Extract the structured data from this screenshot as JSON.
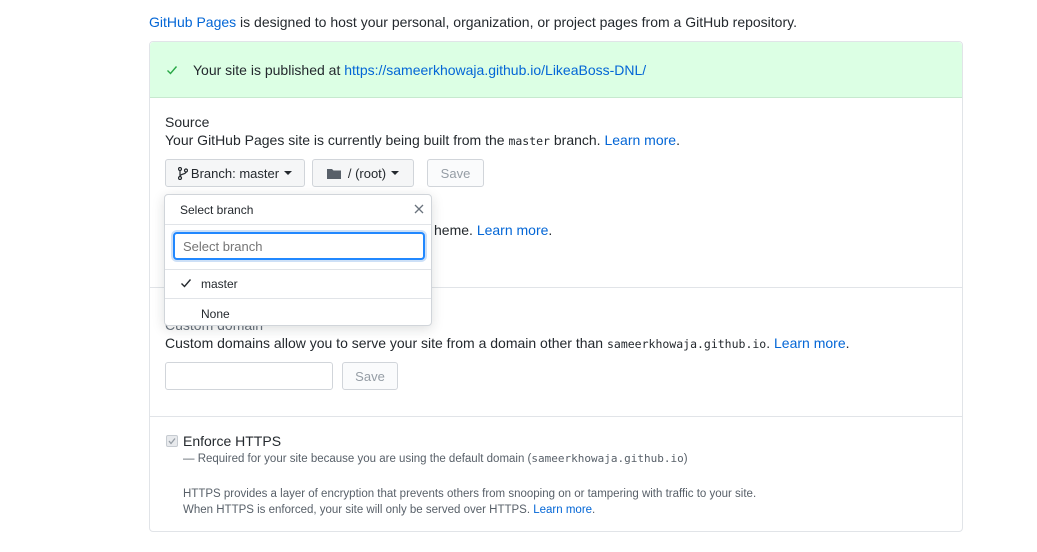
{
  "intro": {
    "link": "GitHub Pages",
    "text": " is designed to host your personal, organization, or project pages from a GitHub repository."
  },
  "flash": {
    "message": "Your site is published at ",
    "url": "https://sameerkhowaja.github.io/LikeaBoss-DNL/",
    "color": "#dcffe4"
  },
  "source": {
    "title": "Source",
    "desc_before": "Your GitHub Pages site is currently being built from the ",
    "branch_code": "master",
    "desc_after": " branch. ",
    "learn_more": "Learn more",
    "period": ".",
    "branch_button": "Branch: master",
    "folder_button": "/ (root)",
    "save_button": "Save"
  },
  "theme": {
    "fragment": "heme. ",
    "learn_more": "Learn more",
    "period": "."
  },
  "custom_domain": {
    "title": "Custom domain",
    "desc_before": "Custom domains allow you to serve your site from a domain other than ",
    "domain_code": "sameerkhowaja.github.io",
    "desc_after": ". ",
    "learn_more": "Learn more",
    "period": ".",
    "input_value": "",
    "save_button": "Save"
  },
  "https": {
    "title": "Enforce HTTPS",
    "sub_before": "— Required for your site because you are using the default domain (",
    "sub_code": "sameerkhowaja.github.io",
    "sub_after": ")",
    "note1": "HTTPS provides a layer of encryption that prevents others from snooping on or tampering with traffic to your site.",
    "note2_before": "When HTTPS is enforced, your site will only be served over HTTPS. ",
    "learn_more": "Learn more",
    "period": "."
  },
  "dropdown": {
    "title": "Select branch",
    "placeholder": "Select branch",
    "items": [
      {
        "label": "master",
        "selected": true
      },
      {
        "label": "None",
        "selected": false
      }
    ]
  }
}
